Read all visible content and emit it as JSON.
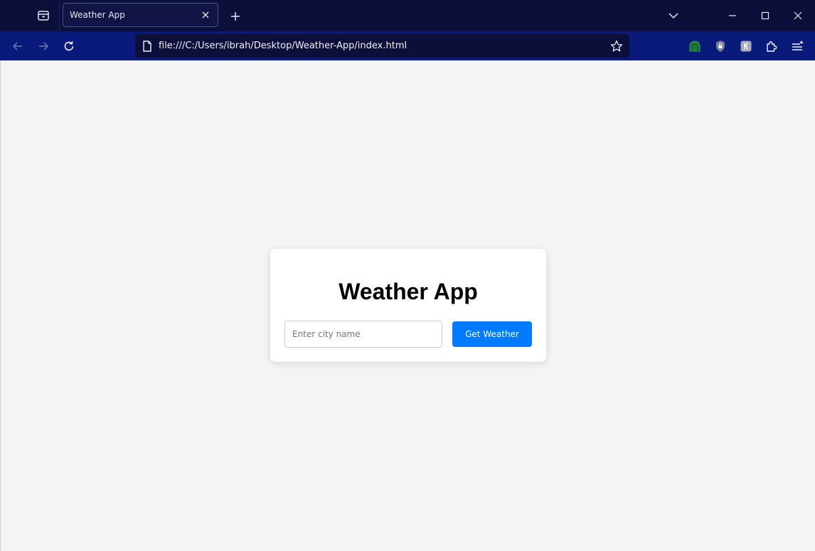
{
  "browser": {
    "tab": {
      "title": "Weather App"
    },
    "url": "file:///C:/Users/ibrah/Desktop/Weather-App/index.html",
    "icons": {
      "tab_overview": "tab-overview-icon",
      "tab_close": "close-icon",
      "new_tab": "plus-icon",
      "tab_list": "chevron-down-icon",
      "minimize": "minimize-icon",
      "maximize": "maximize-icon",
      "close_window": "close-icon",
      "back": "arrow-left-icon",
      "forward": "arrow-right-icon",
      "reload": "reload-icon",
      "page": "page-icon",
      "bookmark": "star-icon",
      "extensions": [
        "green-extension-icon",
        "shield-lock-icon",
        "gray-extension-icon",
        "puzzle-icon"
      ],
      "menu": "hamburger-menu-icon"
    }
  },
  "app": {
    "title": "Weather App",
    "input": {
      "placeholder": "Enter city name",
      "value": ""
    },
    "button_label": "Get Weather"
  },
  "colors": {
    "tabstrip_bg": "#0b0f3a",
    "navbar_bg": "#0a1a7a",
    "page_bg": "#f4f4f4",
    "button_bg": "#007bff"
  }
}
